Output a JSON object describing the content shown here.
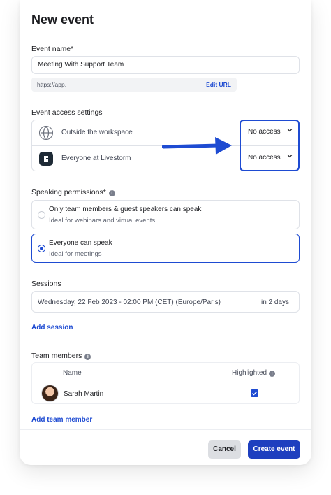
{
  "modal": {
    "title": "New event",
    "event_name": {
      "label": "Event name*",
      "value": "Meeting With Support Team",
      "url_prefix": "https://app.",
      "edit_url_label": "Edit URL"
    },
    "access": {
      "label": "Event access settings",
      "rows": [
        {
          "icon": "globe-icon",
          "label": "Outside the workspace",
          "value": "No access"
        },
        {
          "icon": "livestorm-logo-icon",
          "label": "Everyone at Livestorm",
          "value": "No access"
        }
      ]
    },
    "speaking": {
      "label": "Speaking permissions*",
      "options": [
        {
          "title": "Only team members & guest speakers can speak",
          "subtitle": "Ideal for webinars and virtual events",
          "selected": false
        },
        {
          "title": "Everyone can speak",
          "subtitle": "Ideal for meetings",
          "selected": true
        }
      ]
    },
    "sessions": {
      "label": "Sessions",
      "items": [
        {
          "date": "Wednesday, 22 Feb 2023 - 02:00 PM (CET) (Europe/Paris)",
          "relative": "in 2 days"
        }
      ],
      "add_label": "Add session"
    },
    "team": {
      "label": "Team members",
      "col_name": "Name",
      "col_highlighted": "Highlighted",
      "members": [
        {
          "name": "Sarah Martin",
          "highlighted": true
        }
      ],
      "add_label": "Add team member"
    },
    "footer": {
      "cancel_label": "Cancel",
      "create_label": "Create event"
    }
  },
  "colors": {
    "accent": "#1e4bd2",
    "primary_button": "#1e3fbf",
    "secondary_button": "#dcdee2",
    "border": "#dfe2e8"
  }
}
